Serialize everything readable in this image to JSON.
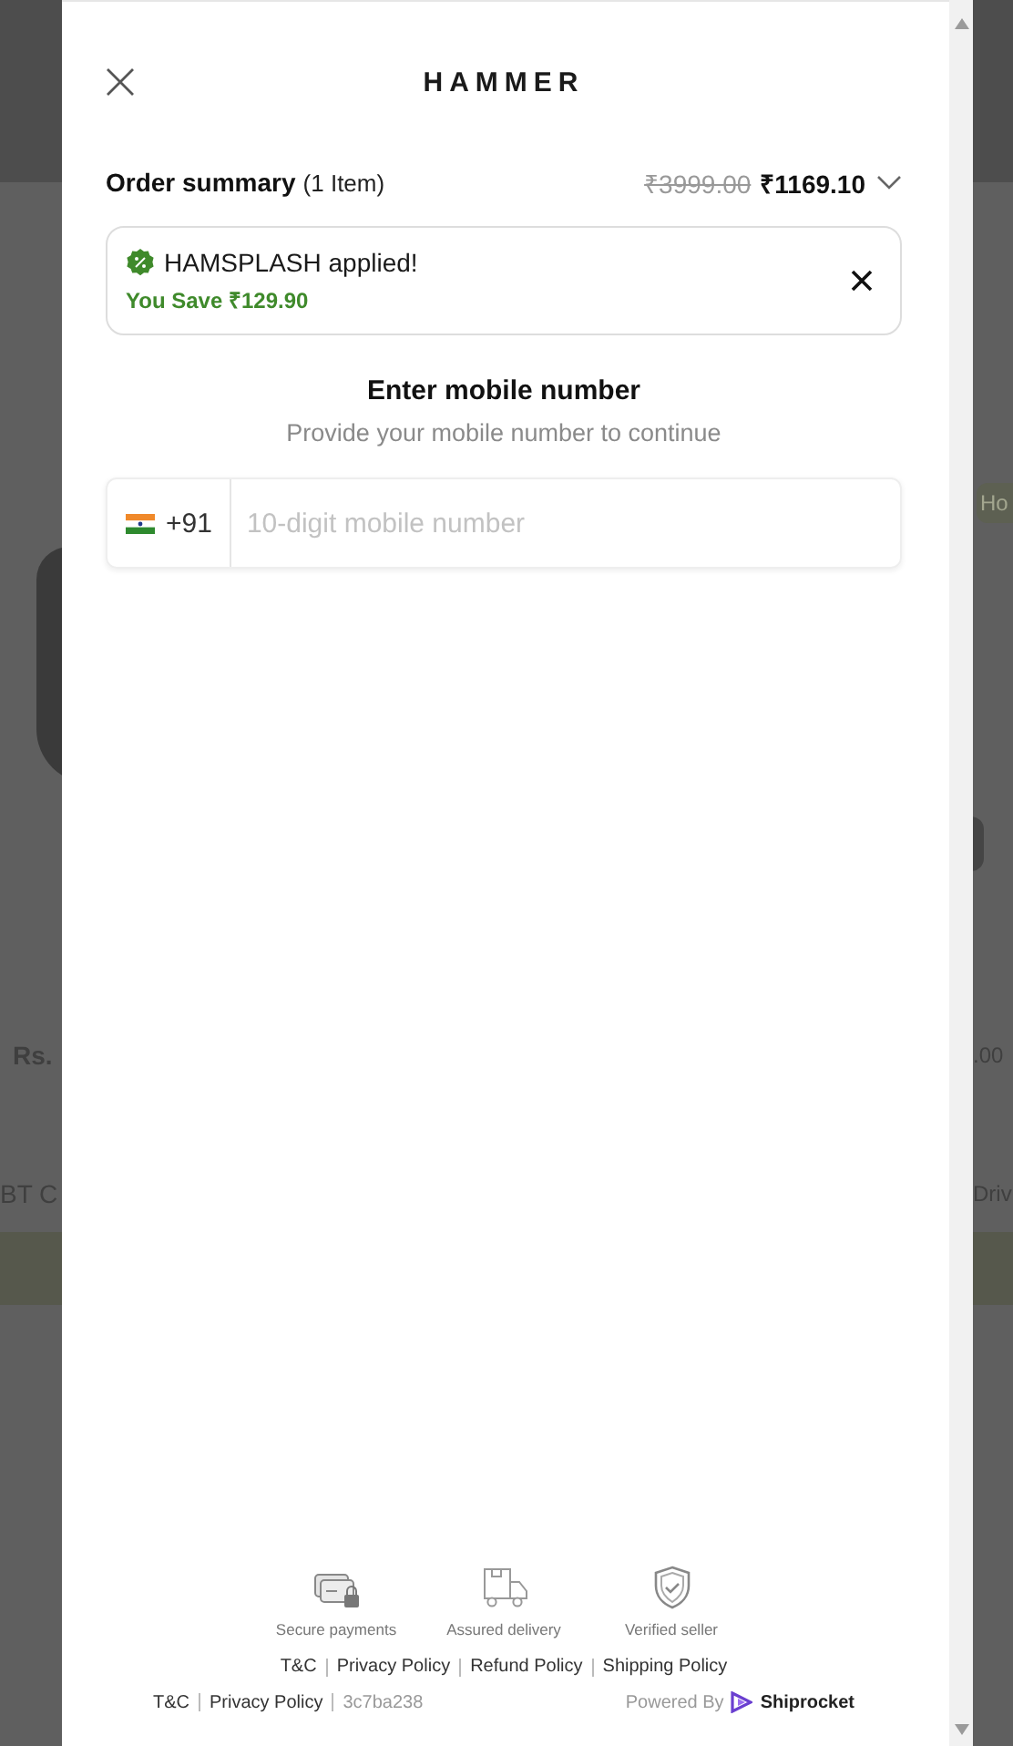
{
  "background_page": {
    "left_texts": [
      "Rs.",
      "BT C"
    ],
    "badge": "Ho",
    "right_texts": [
      ".00",
      "Driv"
    ]
  },
  "header": {
    "logo": "HAMMER"
  },
  "order_summary": {
    "title": "Order summary",
    "count": "(1 Item)",
    "original_price": "₹3999.00",
    "price": "₹1169.10",
    "expanded": false
  },
  "coupon": {
    "title": "HAMSPLASH applied!",
    "savings": "You Save ₹129.90"
  },
  "login": {
    "title": "Enter mobile number",
    "subtitle": "Provide your mobile number to continue",
    "country_code": "+91",
    "placeholder": "10-digit mobile number"
  },
  "trust_badges": [
    {
      "kind": "payment",
      "label": "Secure payments"
    },
    {
      "kind": "delivery",
      "label": "Assured delivery"
    },
    {
      "kind": "seller",
      "label": "Verified seller"
    }
  ],
  "policy_links": [
    "T&C",
    "Privacy Policy",
    "Refund Policy",
    "Shipping Policy"
  ],
  "footer": {
    "links": [
      "T&C",
      "Privacy Policy"
    ],
    "build": "3c7ba238",
    "powered_by": "Powered By",
    "brand": "Shiprocket"
  }
}
